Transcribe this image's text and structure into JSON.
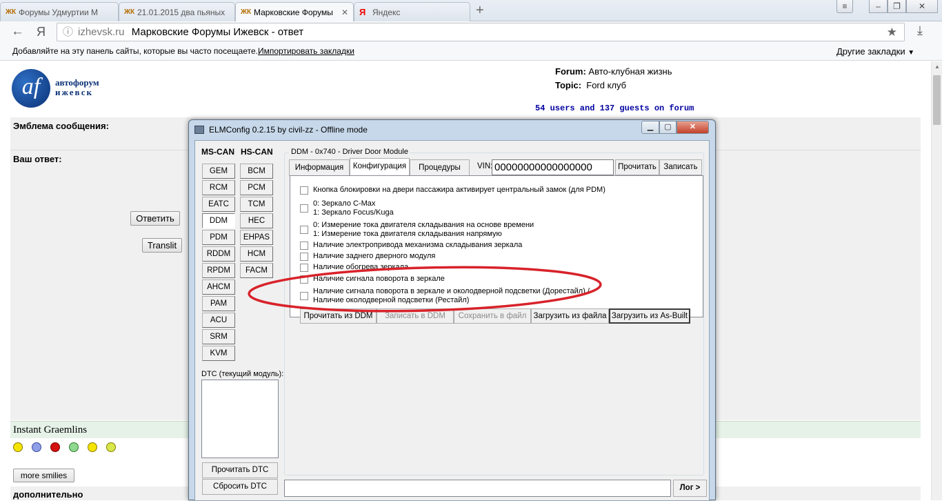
{
  "browser": {
    "tabs": [
      {
        "label": "Форумы Удмуртии М",
        "icon": "forum-favicon-icon"
      },
      {
        "label": "21.01.2015 два пьяных",
        "icon": "forum-favicon-icon"
      },
      {
        "label": "Марковские Форумы",
        "icon": "forum-favicon-icon"
      },
      {
        "label": "Яндекс",
        "icon": "yandex-icon"
      }
    ],
    "yandex_letter": "Я",
    "address_domain": "izhevsk.ru",
    "address_title": "Марковские Форумы Ижевск - ответ",
    "bookmarks_hint": "Добавляйте на эту панель сайты, которые вы часто посещаете.",
    "import_bookmarks": "Импортировать закладки",
    "other_bookmarks": "Другие закладки"
  },
  "forum": {
    "logo_line1": "автофорум",
    "logo_line2": "ижевск",
    "logo_mark": "af",
    "forum_label": "Forum:",
    "forum_value": "Авто-клубная жизнь",
    "topic_label": "Topic:",
    "topic_value": "Ford клуб",
    "online": "54 users and 137 guests on forum",
    "emblem_label": "Эмблема сообщения:",
    "reply_label": "Ваш ответ:",
    "reply_button": "Ответить",
    "translit_button": "Translit",
    "instant_graemlins": "Instant Graemlins",
    "more_smilies": "more smilies",
    "extra_label": "дополнительно"
  },
  "elm": {
    "title": "ELMConfig 0.2.15 by civil-zz - Offline mode",
    "ms_can_label": "MS-CAN",
    "hs_can_label": "HS-CAN",
    "ms_modules": [
      "GEM",
      "RCM",
      "EATC",
      "DDM",
      "PDM",
      "RDDM",
      "RPDM",
      "AHCM",
      "PAM",
      "ACU",
      "SRM",
      "KVM"
    ],
    "hs_modules": [
      "BCM",
      "PCM",
      "TCM",
      "HEC",
      "EHPAS",
      "HCM",
      "FACM"
    ],
    "selected_module": "DDM",
    "dtc_label": "DTC (текущий модуль):",
    "read_dtc": "Прочитать DTC",
    "reset_dtc": "Сбросить DTC",
    "group_title": "DDM - 0x740 - Driver Door Module",
    "tabs": [
      "Информация",
      "Конфигурация",
      "Процедуры"
    ],
    "selected_tab": "Конфигурация",
    "vin_label": "VIN:",
    "vin_value": "00000000000000000",
    "read_button": "Прочитать",
    "write_button": "Записать",
    "options": [
      {
        "line1": "Кнопка блокировки на двери пассажира активирует центральный замок (для PDM)",
        "line2": "",
        "checked": false
      },
      {
        "line1": "0: Зеркало C-Max",
        "line2": "1: Зеркало Focus/Kuga",
        "checked": false
      },
      {
        "line1": "0: Измерение тока двигателя складывания на основе времени",
        "line2": "1: Измерение тока двигателя складывания напрямую",
        "checked": false
      },
      {
        "line1": "Наличие электропривода механизма складывания зеркала",
        "line2": "",
        "checked": false
      },
      {
        "line1": "Наличие заднего дверного модуля",
        "line2": "",
        "checked": false
      },
      {
        "line1": "Наличие обогрева зеркала",
        "line2": "",
        "checked": false
      },
      {
        "line1": "Наличие сигнала поворота в зеркале",
        "line2": "",
        "checked": false
      },
      {
        "line1": "Наличие сигнала поворота в зеркале и околодверной подсветки (Дорестайл) /",
        "line2": "Наличие околодверной подсветки (Рестайл)",
        "checked": false
      }
    ],
    "action_buttons": [
      {
        "label": "Прочитать из DDM",
        "enabled": true
      },
      {
        "label": "Записать в DDM",
        "enabled": false
      },
      {
        "label": "Сохранить в файл",
        "enabled": false
      },
      {
        "label": "Загрузить из файла",
        "enabled": true
      },
      {
        "label": "Загрузить из As-Built",
        "enabled": true
      }
    ],
    "log_button": "Лог >"
  },
  "colors": {
    "annotation_ellipse": "#d8222a",
    "online_text": "#0000a0",
    "forum_header_bg": "#f0f0f0"
  }
}
